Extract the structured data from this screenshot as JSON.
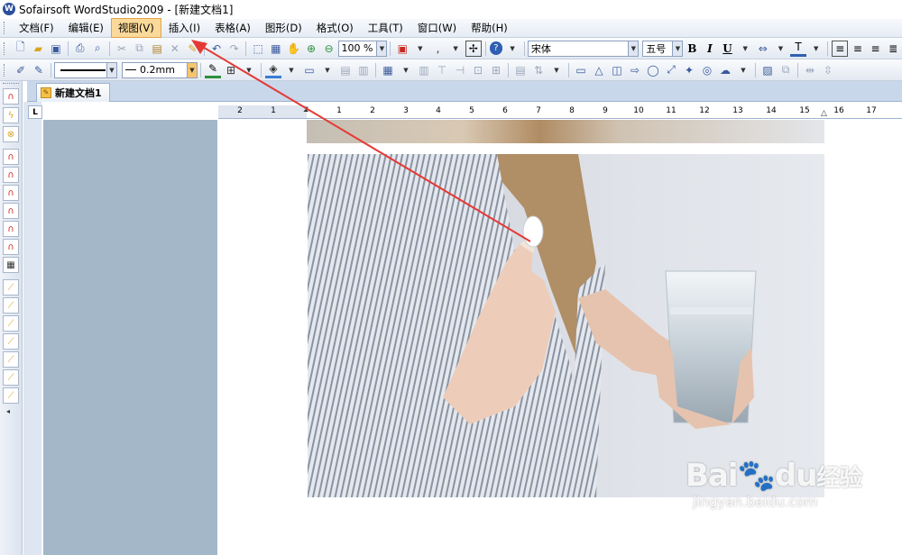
{
  "window": {
    "title": "Sofairsoft WordStudio2009 - [新建文档1]",
    "app_icon": "W"
  },
  "menu": {
    "items": [
      {
        "label": "文档(F)",
        "active": false
      },
      {
        "label": "编辑(E)",
        "active": false
      },
      {
        "label": "视图(V)",
        "active": true
      },
      {
        "label": "插入(I)",
        "active": false
      },
      {
        "label": "表格(A)",
        "active": false
      },
      {
        "label": "图形(D)",
        "active": false
      },
      {
        "label": "格式(O)",
        "active": false
      },
      {
        "label": "工具(T)",
        "active": false
      },
      {
        "label": "窗口(W)",
        "active": false
      },
      {
        "label": "帮助(H)",
        "active": false
      }
    ]
  },
  "toolbar": {
    "zoom": "100 %",
    "font_name": "宋体",
    "font_size": "五号",
    "bold": "B",
    "italic": "I",
    "underline": "U",
    "line_width": "0.2mm"
  },
  "tabs": [
    {
      "label": "新建文档1"
    }
  ],
  "ruler": {
    "labels": [
      "2",
      "1",
      "1",
      "2",
      "3",
      "4",
      "5",
      "6",
      "7",
      "8",
      "9",
      "10",
      "11",
      "12",
      "13",
      "14",
      "15",
      "16",
      "17"
    ]
  },
  "watermark": {
    "logo_a": "Bai",
    "logo_b": "du",
    "logo_c": "经验",
    "sub": "jingyan.baidu.com"
  },
  "colors": {
    "menu_active": "#fbd99a",
    "annotation_arrow": "#e53935",
    "workspace_gray": "#a4b7c9"
  }
}
